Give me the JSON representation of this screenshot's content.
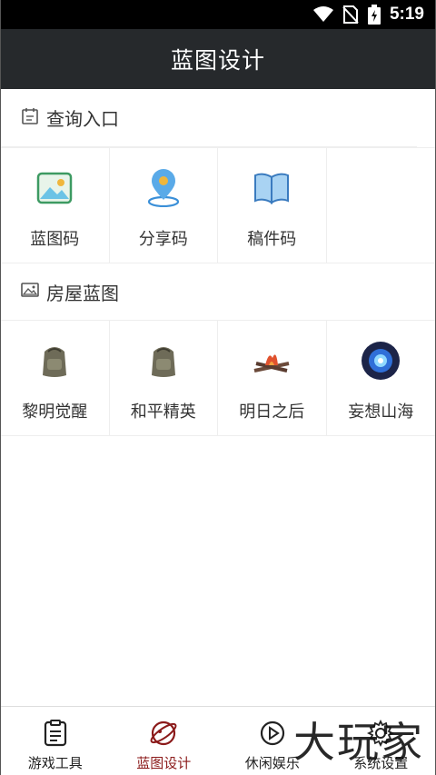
{
  "status_bar": {
    "time": "5:19"
  },
  "header": {
    "title": "蓝图设计"
  },
  "query_section": {
    "title": "查询入口",
    "items": [
      {
        "label": "蓝图码",
        "icon": "image-icon"
      },
      {
        "label": "分享码",
        "icon": "location-pin-icon"
      },
      {
        "label": "稿件码",
        "icon": "open-book-icon"
      }
    ]
  },
  "house_section": {
    "title": "房屋蓝图",
    "items": [
      {
        "label": "黎明觉醒",
        "icon": "backpack-icon"
      },
      {
        "label": "和平精英",
        "icon": "backpack-icon"
      },
      {
        "label": "明日之后",
        "icon": "campfire-icon"
      },
      {
        "label": "妄想山海",
        "icon": "blue-orb-icon"
      }
    ]
  },
  "bottom_nav": {
    "tabs": [
      {
        "label": "游戏工具",
        "icon": "clipboard-icon",
        "active": false
      },
      {
        "label": "蓝图设计",
        "icon": "planet-icon",
        "active": true
      },
      {
        "label": "休闲娱乐",
        "icon": "play-circle-icon",
        "active": false
      },
      {
        "label": "系统设置",
        "icon": "gear-icon",
        "active": false
      }
    ]
  },
  "watermark": {
    "text": "大玩家"
  },
  "colors": {
    "header_bg": "#26292c",
    "active_tab": "#8b1a1a",
    "accent_blue": "#3a8fd8"
  }
}
